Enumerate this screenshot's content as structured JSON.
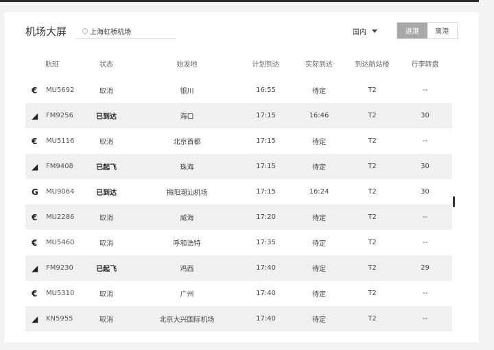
{
  "header": {
    "title": "机场大屏",
    "airport": "上海虹桥机场",
    "region": "国内",
    "tabs": [
      "进港",
      "离港"
    ],
    "active_tab": "进港"
  },
  "columns": [
    "航班",
    "状态",
    "始发地",
    "计划到达",
    "实际到达",
    "到达航站楼",
    "行李转盘"
  ],
  "flights": [
    {
      "logo": "china-eastern-icon",
      "glyph": "€",
      "flight": "MU5692",
      "status": "取消",
      "bold": false,
      "origin": "银川",
      "scheduled": "16:55",
      "actual": "待定",
      "terminal": "T2",
      "carousel": "--"
    },
    {
      "logo": "shanghai-airlines-icon",
      "glyph": "◢",
      "flight": "FM9256",
      "status": "已到达",
      "bold": true,
      "origin": "海口",
      "scheduled": "17:15",
      "actual": "16:46",
      "terminal": "T2",
      "carousel": "30"
    },
    {
      "logo": "china-eastern-icon",
      "glyph": "€",
      "flight": "MU5116",
      "status": "取消",
      "bold": false,
      "origin": "北京首都",
      "scheduled": "17:15",
      "actual": "待定",
      "terminal": "T2",
      "carousel": "--"
    },
    {
      "logo": "shanghai-airlines-icon",
      "glyph": "◢",
      "flight": "FM9408",
      "status": "已起飞",
      "bold": true,
      "origin": "珠海",
      "scheduled": "17:15",
      "actual": "待定",
      "terminal": "T2",
      "carousel": "30"
    },
    {
      "logo": "china-united-icon",
      "glyph": "G",
      "flight": "MU9064",
      "status": "已到达",
      "bold": true,
      "origin": "揭阳潮汕机场",
      "scheduled": "17:15",
      "actual": "16:24",
      "terminal": "T2",
      "carousel": "30"
    },
    {
      "logo": "china-eastern-icon",
      "glyph": "€",
      "flight": "MU2286",
      "status": "取消",
      "bold": false,
      "origin": "威海",
      "scheduled": "17:20",
      "actual": "待定",
      "terminal": "T2",
      "carousel": "--"
    },
    {
      "logo": "china-eastern-icon",
      "glyph": "€",
      "flight": "MU5460",
      "status": "取消",
      "bold": false,
      "origin": "呼和浩特",
      "scheduled": "17:35",
      "actual": "待定",
      "terminal": "T2",
      "carousel": "--"
    },
    {
      "logo": "shanghai-airlines-icon",
      "glyph": "◢",
      "flight": "FM9230",
      "status": "已起飞",
      "bold": true,
      "origin": "鸡西",
      "scheduled": "17:40",
      "actual": "待定",
      "terminal": "T2",
      "carousel": "29"
    },
    {
      "logo": "china-eastern-icon",
      "glyph": "€",
      "flight": "MU5310",
      "status": "取消",
      "bold": false,
      "origin": "广州",
      "scheduled": "17:40",
      "actual": "待定",
      "terminal": "T2",
      "carousel": "--"
    },
    {
      "logo": "shanghai-airlines-icon",
      "glyph": "◢",
      "flight": "KN5955",
      "status": "取消",
      "bold": false,
      "origin": "北京大兴国际机场",
      "scheduled": "17:40",
      "actual": "待定",
      "terminal": "T2",
      "carousel": "--"
    }
  ]
}
